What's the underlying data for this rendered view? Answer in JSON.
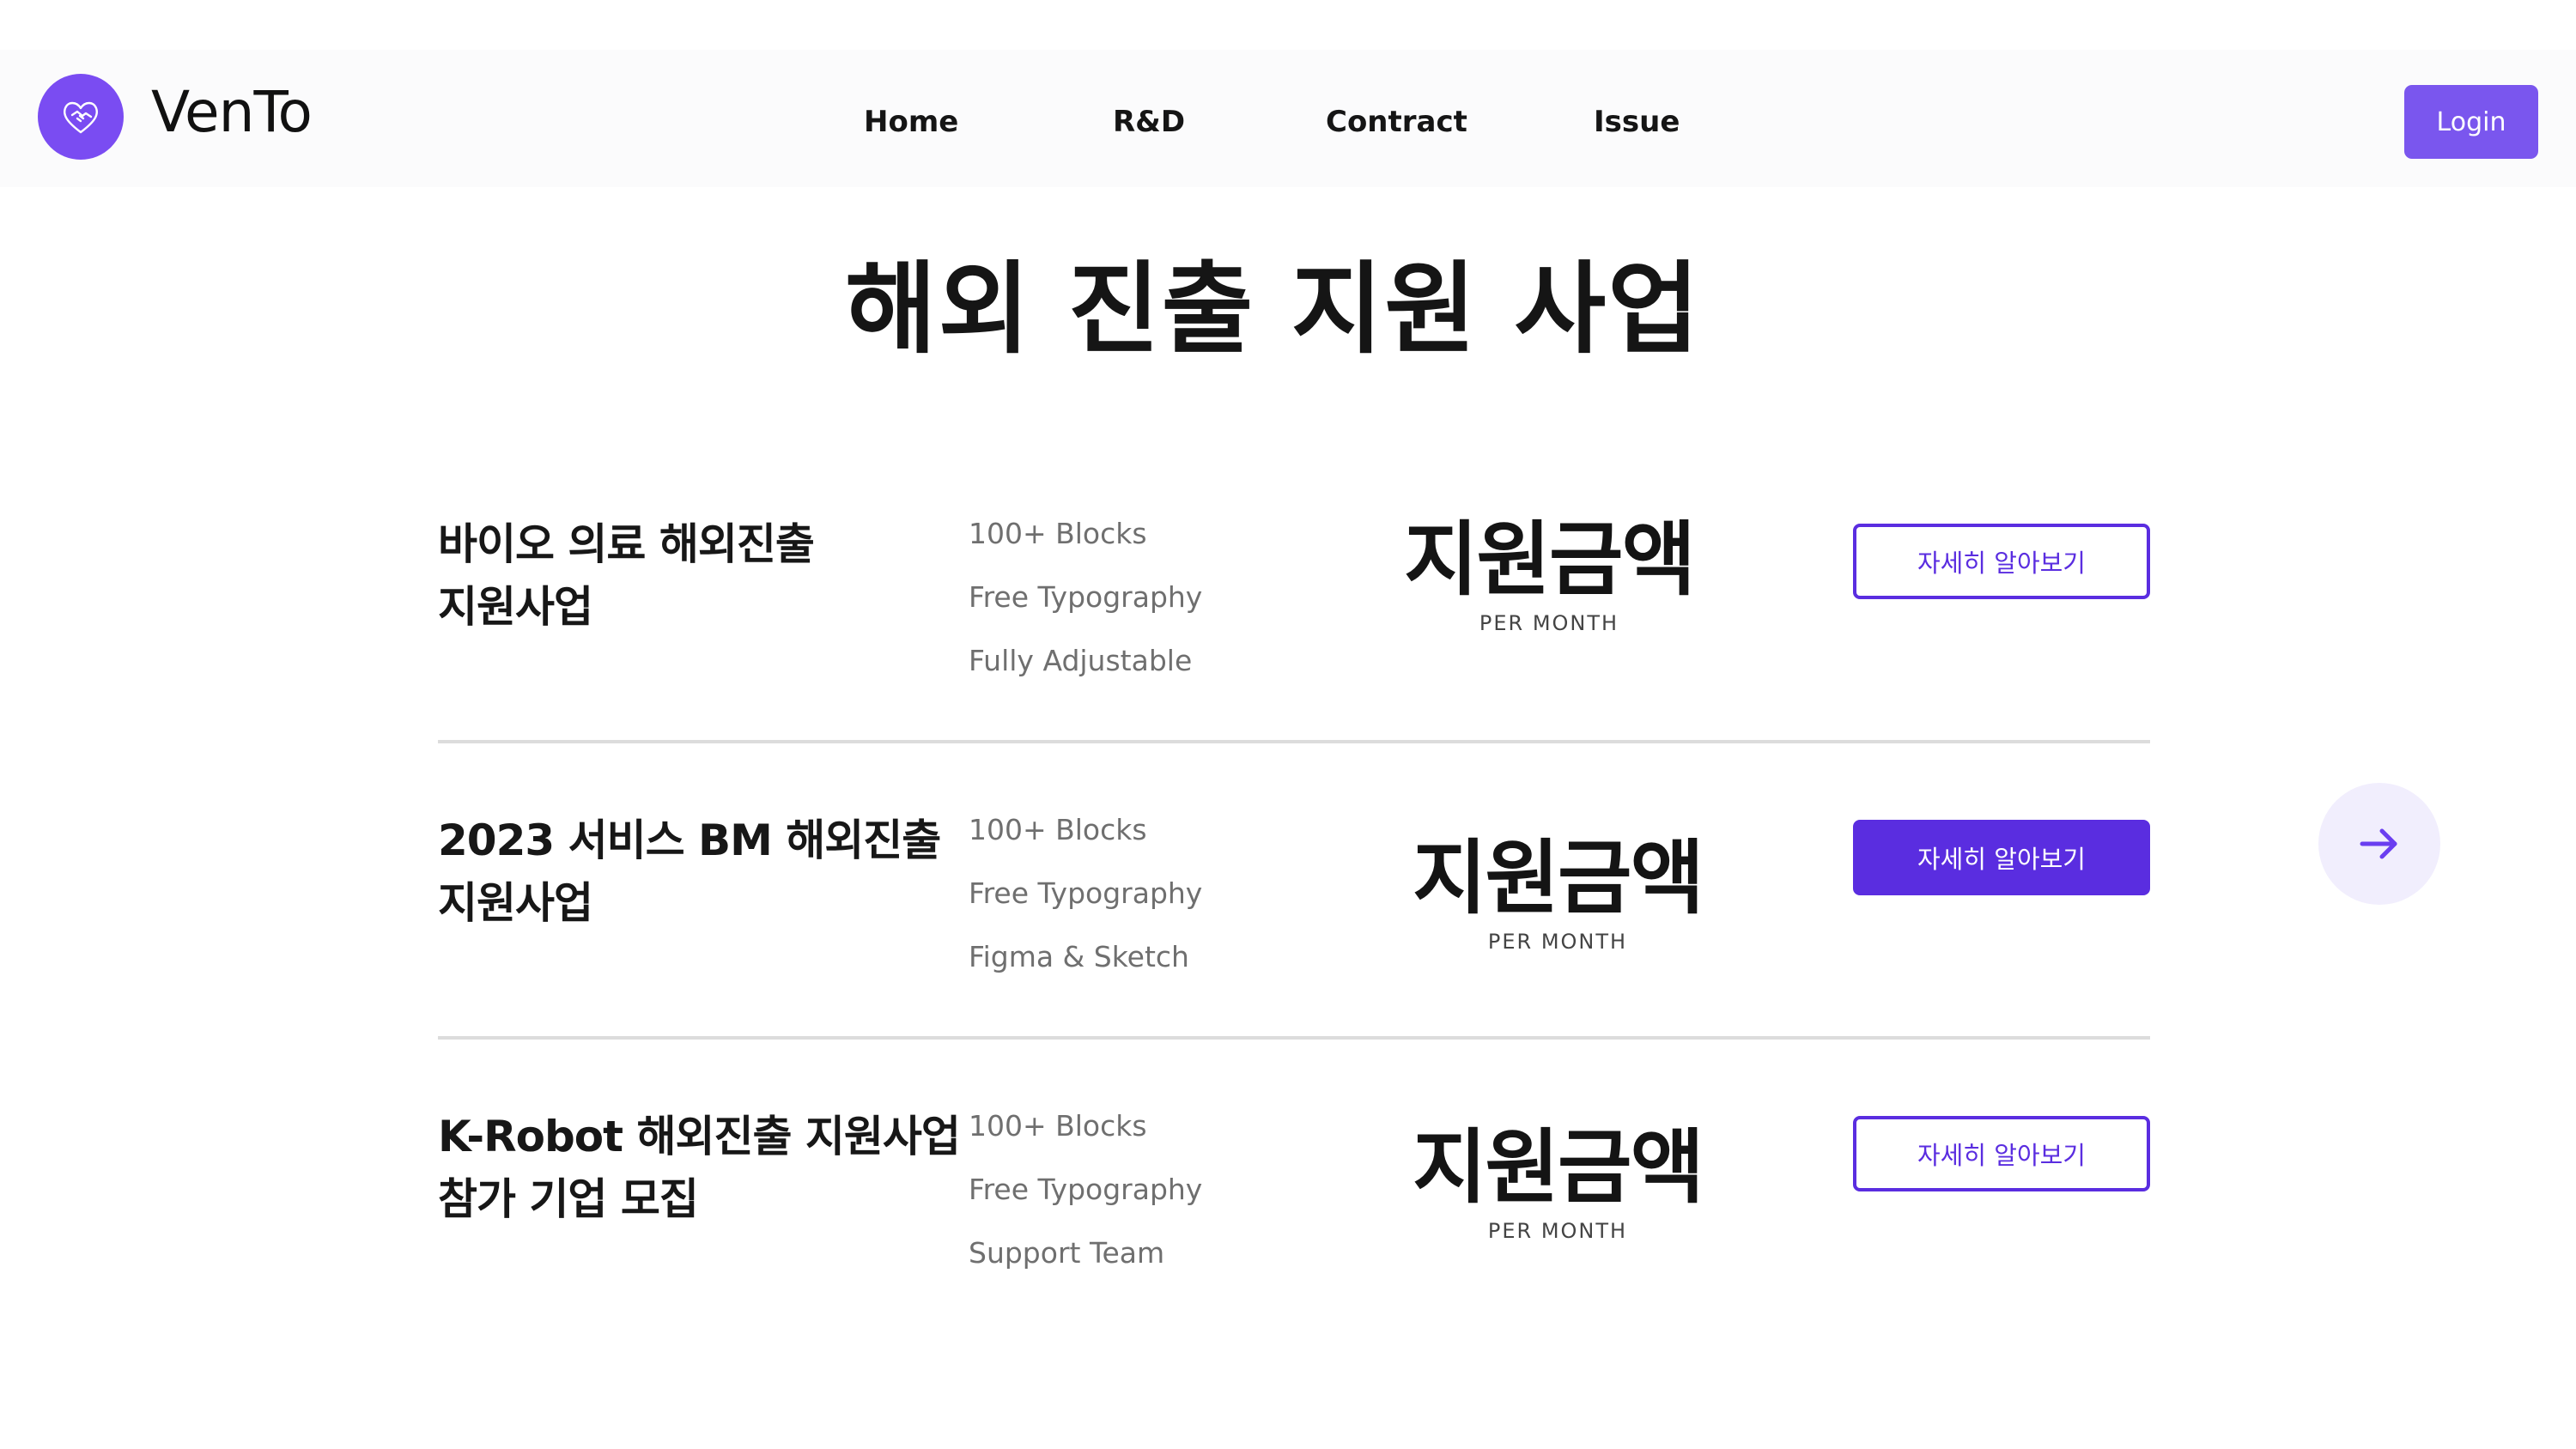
{
  "brand": {
    "name": "VenTo",
    "logo_icon": "heart-handshake-icon",
    "accent": "#7a4cf2"
  },
  "nav": {
    "items": [
      {
        "label": "Home"
      },
      {
        "label": "R&D"
      },
      {
        "label": "Contract"
      },
      {
        "label": "Issue"
      }
    ],
    "login_label": "Login"
  },
  "page": {
    "title": "해외 진출 지원 사업"
  },
  "programs": [
    {
      "title_line1": "바이오 의료 해외진출",
      "title_line2": "지원사업",
      "features": [
        "100+ Blocks",
        "Free Typography",
        "Fully Adjustable"
      ],
      "amount": "지원금액",
      "amount_caption": "PER MONTH",
      "button_label": "자세히 알아보기",
      "button_active": false
    },
    {
      "title_line1": "2023 서비스 BM 해외진출",
      "title_line2": "지원사업",
      "features": [
        "100+ Blocks",
        "Free Typography",
        "Figma & Sketch"
      ],
      "amount": "지원금액",
      "amount_caption": "PER MONTH",
      "button_label": "자세히 알아보기",
      "button_active": true
    },
    {
      "title_line1": "K-Robot 해외진출 지원사업",
      "title_line2": "참가 기업 모집",
      "features": [
        "100+ Blocks",
        "Free Typography",
        "Support Team"
      ],
      "amount": "지원금액",
      "amount_caption": "PER MONTH",
      "button_label": "자세히 알아보기",
      "button_active": false
    }
  ],
  "carousel": {
    "next_icon": "arrow-right-icon"
  },
  "colors": {
    "primary": "#5a2de0",
    "login_bg": "#7a56ee",
    "divider": "#dcdcdc"
  }
}
